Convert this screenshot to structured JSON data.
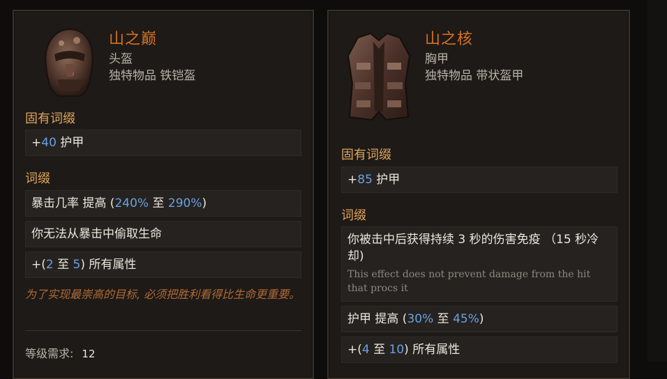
{
  "items": [
    {
      "name": "山之巅",
      "slot": "头盔",
      "type": "独特物品 铁铠盔",
      "implicit_header": "固有词缀",
      "implicit": {
        "plus": "+",
        "num": "40",
        "text": " 护甲"
      },
      "affix_header": "词缀",
      "affixes": [
        {
          "pre": "暴击几率 提高 (",
          "num1": "240%",
          "mid": " 至 ",
          "num2": "290%",
          "post": ")"
        },
        {
          "text": "你无法从暴击中偷取生命"
        },
        {
          "pre": "+(",
          "num1": "2",
          "mid": " 至 ",
          "num2": "5",
          "post": ") 所有属性"
        }
      ],
      "flavor": "为了实现最崇高的目标, 必须把胜利看得比生命更重要。",
      "requirement_label": "等级需求:",
      "requirement_value": "12"
    },
    {
      "name": "山之核",
      "slot": "胸甲",
      "type": "独特物品 带状盔甲",
      "implicit_header": "固有词缀",
      "implicit": {
        "plus": "+",
        "num": "85",
        "text": " 护甲"
      },
      "affix_header": "词缀",
      "affixes": [
        {
          "text": "你被击中后获得持续 3 秒的伤害免疫 （15 秒冷却)",
          "note": "This effect does not prevent damage from the hit that procs it"
        },
        {
          "pre": "护甲 提高 (",
          "num1": "30%",
          "mid": " 至 ",
          "num2": "45%",
          "post": ")"
        },
        {
          "pre": "+(",
          "num1": "4",
          "mid": " 至 ",
          "num2": "10",
          "post": ") 所有属性"
        }
      ]
    }
  ],
  "colors": {
    "item_name": "#d8701f",
    "section_header": "#e0a45c",
    "number": "#6aa1e0",
    "flavor": "#b06a36"
  },
  "icons": [
    "helmet-icon",
    "chest-armor-icon"
  ]
}
